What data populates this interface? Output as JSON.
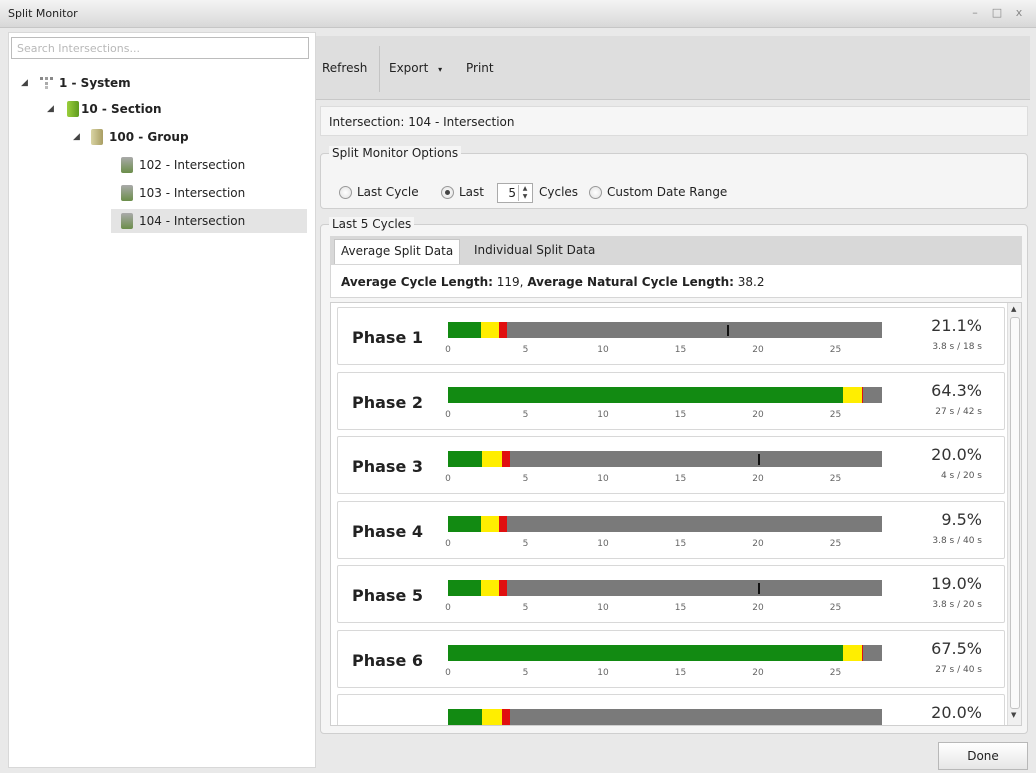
{
  "window": {
    "title": "Split Monitor",
    "controls": [
      "–",
      "□",
      "x"
    ]
  },
  "search": {
    "placeholder": "Search Intersections..."
  },
  "tree": [
    {
      "label": "1 - System",
      "icon": "system-icon"
    },
    {
      "label": "10 - Section",
      "icon": "section-icon"
    },
    {
      "label": "100 - Group",
      "icon": "group-icon"
    },
    {
      "label": "102 - Intersection",
      "icon": "intersection-icon"
    },
    {
      "label": "103 - Intersection",
      "icon": "intersection-icon"
    },
    {
      "label": "104 - Intersection",
      "icon": "intersection-icon",
      "selected": true
    }
  ],
  "toolbar": {
    "refresh": "Refresh",
    "export": "Export",
    "export_arrow": "▾",
    "print": "Print"
  },
  "intersection_text": "Intersection: 104 - Intersection",
  "options": {
    "legend": "Split Monitor Options",
    "last_cycle": "Last Cycle",
    "last": "Last",
    "cycles_value": "5",
    "cycles": "Cycles",
    "custom_range": "Custom Date Range",
    "selected": "last"
  },
  "cycles_group": {
    "legend": "Last 5 Cycles"
  },
  "tabs": {
    "average": "Average Split Data",
    "individual": "Individual Split Data"
  },
  "summary": {
    "avg_label": "Average Cycle Length:",
    "avg_value": "119",
    "sep": ",",
    "nat_label": "Average Natural Cycle Length:",
    "nat_value": "38.2"
  },
  "axis_ticks": [
    "0",
    "5",
    "10",
    "15",
    "20",
    "25"
  ],
  "axis_max": 28,
  "colors": {
    "green": "#128a12",
    "yellow": "#ffee00",
    "red": "#e01010",
    "gray": "#7a7a7a"
  },
  "phases": [
    {
      "name": "Phase 1",
      "percent": "21.1%",
      "detail": "3.8 s / 18 s",
      "green": 2.1,
      "yellow": 1.2,
      "red": 0.5,
      "marker": 18
    },
    {
      "name": "Phase 2",
      "percent": "64.3%",
      "detail": "27 s / 42 s",
      "green": 25.5,
      "yellow": 1.2,
      "red": 0.1,
      "marker": null
    },
    {
      "name": "Phase 3",
      "percent": "20.0%",
      "detail": "4 s / 20 s",
      "green": 2.2,
      "yellow": 1.3,
      "red": 0.5,
      "marker": 20
    },
    {
      "name": "Phase 4",
      "percent": "9.5%",
      "detail": "3.8 s / 40 s",
      "green": 2.1,
      "yellow": 1.2,
      "red": 0.5,
      "marker": null
    },
    {
      "name": "Phase 5",
      "percent": "19.0%",
      "detail": "3.8 s / 20 s",
      "green": 2.1,
      "yellow": 1.2,
      "red": 0.5,
      "marker": 20
    },
    {
      "name": "Phase 6",
      "percent": "67.5%",
      "detail": "27 s / 40 s",
      "green": 25.5,
      "yellow": 1.2,
      "red": 0.1,
      "marker": null
    },
    {
      "name": "",
      "percent": "20.0%",
      "detail": "",
      "green": 2.2,
      "yellow": 1.3,
      "red": 0.5,
      "marker": null
    }
  ],
  "done_label": "Done"
}
